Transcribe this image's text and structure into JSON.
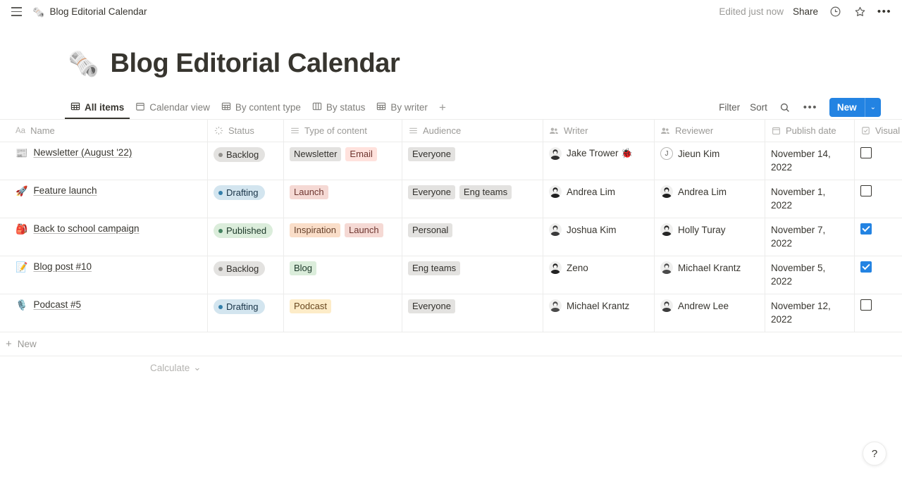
{
  "topbar": {
    "menu_icon": "hamburger-icon",
    "emoji": "🗞️",
    "title": "Blog Editorial Calendar",
    "edited_status": "Edited just now",
    "share_label": "Share",
    "history_icon": "clock-icon",
    "favorite_icon": "star-icon",
    "more_icon": "more-horizontal-icon",
    "more_label": "•••"
  },
  "page": {
    "emoji": "🗞️",
    "title": "Blog Editorial Calendar"
  },
  "tabs": [
    {
      "label": "All items",
      "icon": "table-icon",
      "active": true
    },
    {
      "label": "Calendar view",
      "icon": "calendar-icon",
      "active": false
    },
    {
      "label": "By content type",
      "icon": "table-icon",
      "active": false
    },
    {
      "label": "By status",
      "icon": "board-icon",
      "active": false
    },
    {
      "label": "By writer",
      "icon": "table-icon",
      "active": false
    }
  ],
  "tab_add_label": "+",
  "toolbar": {
    "filter_label": "Filter",
    "sort_label": "Sort",
    "search_icon": "search-icon",
    "more_icon": "more-horizontal-icon",
    "more_label": "•••",
    "new_label": "New",
    "new_caret": "⌄",
    "accent_color": "#2383e2"
  },
  "table": {
    "columns": [
      {
        "label": "Name",
        "icon": "text-type-icon",
        "icon_glyph": "Aa"
      },
      {
        "label": "Status",
        "icon": "status-spinner-icon"
      },
      {
        "label": "Type of content",
        "icon": "multi-select-icon"
      },
      {
        "label": "Audience",
        "icon": "multi-select-icon"
      },
      {
        "label": "Writer",
        "icon": "person-icon"
      },
      {
        "label": "Reviewer",
        "icon": "person-icon"
      },
      {
        "label": "Publish date",
        "icon": "date-icon"
      },
      {
        "label": "Visual",
        "icon": "checkbox-icon"
      }
    ],
    "rows": [
      {
        "emoji": "📰",
        "name": "Newsletter (August '22)",
        "status": {
          "label": "Backlog",
          "dot": "#918f8b",
          "bg": "#e3e2e0",
          "fg": "#32302c"
        },
        "types": [
          {
            "label": "Newsletter",
            "bg": "#e3e2e0",
            "fg": "#32302c"
          },
          {
            "label": "Email",
            "bg": "#ffe2dd",
            "fg": "#6e3630"
          }
        ],
        "audience": [
          {
            "label": "Everyone",
            "bg": "#e3e2e0",
            "fg": "#32302c"
          }
        ],
        "writer": {
          "name": "Jake Trower 🐞",
          "avatar": "photo",
          "avatar_color": "#2f2f2f"
        },
        "reviewer": {
          "name": "Jieun Kim",
          "avatar": "letter",
          "initial": "J"
        },
        "publish_date": "November 14, 2022",
        "visual_ready": false
      },
      {
        "emoji": "🚀",
        "name": "Feature launch",
        "status": {
          "label": "Drafting",
          "dot": "#337ea9",
          "bg": "#d3e5ef",
          "fg": "#183347"
        },
        "types": [
          {
            "label": "Launch",
            "bg": "#f5d9d4",
            "fg": "#6e3630"
          }
        ],
        "audience": [
          {
            "label": "Everyone",
            "bg": "#e3e2e0",
            "fg": "#32302c"
          },
          {
            "label": "Eng teams",
            "bg": "#e3e2e0",
            "fg": "#32302c"
          }
        ],
        "writer": {
          "name": "Andrea Lim",
          "avatar": "photo",
          "avatar_color": "#1f1f1f"
        },
        "reviewer": {
          "name": "Andrea Lim",
          "avatar": "photo",
          "avatar_color": "#1f1f1f"
        },
        "publish_date": "November 1, 2022",
        "visual_ready": false
      },
      {
        "emoji": "🎒",
        "name": "Back to school campaign",
        "status": {
          "label": "Published",
          "dot": "#448361",
          "bg": "#dbeddb",
          "fg": "#1c3829"
        },
        "types": [
          {
            "label": "Inspiration",
            "bg": "#fadec9",
            "fg": "#66402a"
          },
          {
            "label": "Launch",
            "bg": "#f5d9d4",
            "fg": "#6e3630"
          }
        ],
        "audience": [
          {
            "label": "Personal",
            "bg": "#e3e2e0",
            "fg": "#32302c"
          }
        ],
        "writer": {
          "name": "Joshua Kim",
          "avatar": "photo",
          "avatar_color": "#3a3a3a"
        },
        "reviewer": {
          "name": "Holly Turay",
          "avatar": "photo",
          "avatar_color": "#262626"
        },
        "publish_date": "November 7, 2022",
        "visual_ready": true
      },
      {
        "emoji": "📝",
        "name": "Blog post #10",
        "status": {
          "label": "Backlog",
          "dot": "#918f8b",
          "bg": "#e3e2e0",
          "fg": "#32302c"
        },
        "types": [
          {
            "label": "Blog",
            "bg": "#dbeddb",
            "fg": "#1c3829"
          }
        ],
        "audience": [
          {
            "label": "Eng teams",
            "bg": "#e3e2e0",
            "fg": "#32302c"
          }
        ],
        "writer": {
          "name": "Zeno",
          "avatar": "photo",
          "avatar_color": "#222222"
        },
        "reviewer": {
          "name": "Michael Krantz",
          "avatar": "photo",
          "avatar_color": "#4a4a4a"
        },
        "publish_date": "November 5, 2022",
        "visual_ready": true
      },
      {
        "emoji": "🎙️",
        "name": "Podcast #5",
        "status": {
          "label": "Drafting",
          "dot": "#337ea9",
          "bg": "#d3e5ef",
          "fg": "#183347"
        },
        "types": [
          {
            "label": "Podcast",
            "bg": "#fdecc8",
            "fg": "#69481f"
          }
        ],
        "audience": [
          {
            "label": "Everyone",
            "bg": "#e3e2e0",
            "fg": "#32302c"
          }
        ],
        "writer": {
          "name": "Michael Krantz",
          "avatar": "photo",
          "avatar_color": "#4a4a4a"
        },
        "reviewer": {
          "name": "Andrew Lee",
          "avatar": "photo",
          "avatar_color": "#3d3d3d"
        },
        "publish_date": "November 12, 2022",
        "visual_ready": false
      }
    ]
  },
  "footer": {
    "new_row_label": "New",
    "new_row_icon": "plus-icon",
    "calculate_label": "Calculate",
    "calculate_caret": "⌄"
  },
  "help": {
    "label": "?",
    "icon": "question-mark-icon"
  }
}
